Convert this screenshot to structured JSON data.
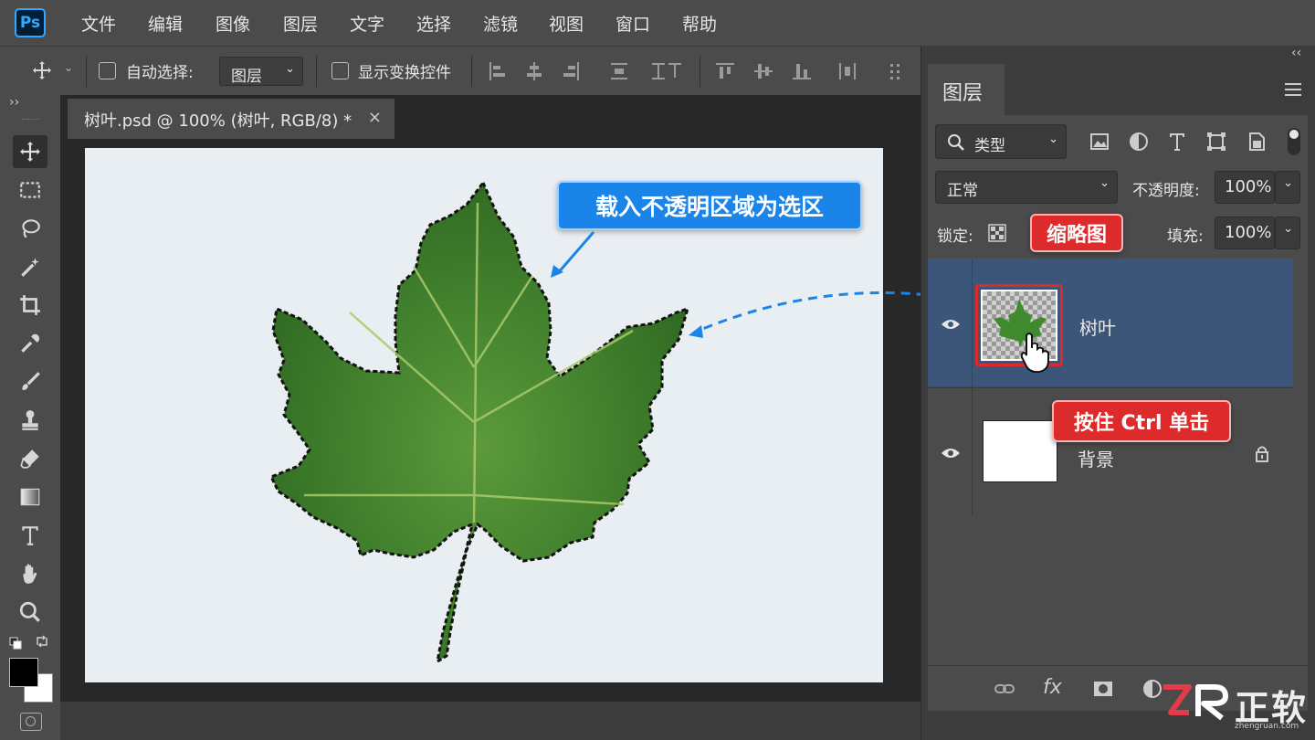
{
  "app": {
    "logo": "Ps"
  },
  "menu": [
    "文件",
    "编辑",
    "图像",
    "图层",
    "文字",
    "选择",
    "滤镜",
    "视图",
    "窗口",
    "帮助"
  ],
  "options": {
    "auto_select_label": "自动选择:",
    "auto_select_value": "图层",
    "show_transform_label": "显示变换控件"
  },
  "document_tab": {
    "title": "树叶.psd  @ 100% (树叶, RGB/8) *",
    "close": "×"
  },
  "layers_panel": {
    "title": "图层",
    "filter_value": "类型",
    "blend_mode": "正常",
    "opacity_label": "不透明度:",
    "opacity_value": "100%",
    "lock_label": "锁定:",
    "fill_label": "填充:",
    "fill_value": "100%",
    "layers": [
      {
        "name": "树叶",
        "selected": true
      },
      {
        "name": "背景",
        "selected": false,
        "locked": true
      }
    ]
  },
  "callouts": {
    "load_selection": "载入不透明区域为选区",
    "thumbnail": "缩略图",
    "ctrl_click": "按住 Ctrl 单击"
  },
  "brand": {
    "name": "正软",
    "url": "zhengruan.com"
  },
  "colors": {
    "accent_blue": "#1a84e8",
    "accent_red": "#dd2a2a",
    "selected_layer": "#3b5679"
  }
}
